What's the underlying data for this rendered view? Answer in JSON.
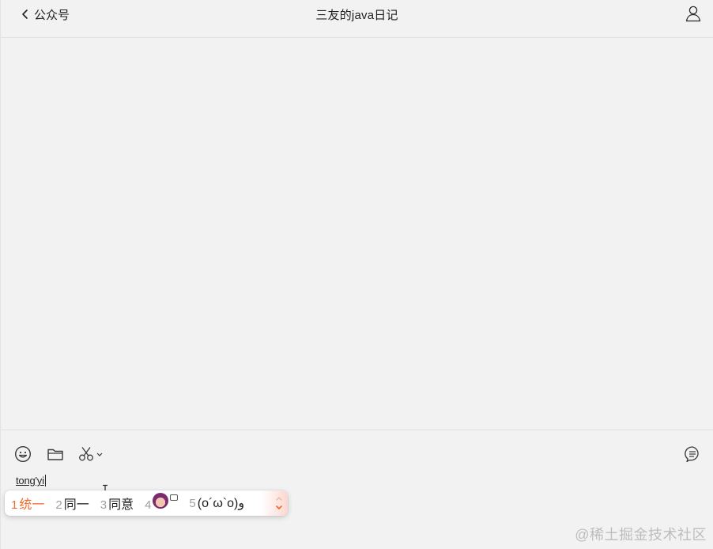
{
  "header": {
    "back_label": "公众号",
    "title": "三友的java日记"
  },
  "composer": {
    "typed_text": "tong'yi"
  },
  "ime": {
    "candidates": [
      {
        "num": "1",
        "text": "统一"
      },
      {
        "num": "2",
        "text": "同一"
      },
      {
        "num": "3",
        "text": "同意"
      },
      {
        "num": "4",
        "text": ""
      },
      {
        "num": "5",
        "text": "(o´ω`o)ﻭ"
      }
    ],
    "selected_index": 0
  },
  "watermark": "@稀土掘金技术社区",
  "colors": {
    "background": "#f2f2f2",
    "accent_selected": "#ee6b2c",
    "border": "#e1e1e1"
  },
  "icons": {
    "back": "chevron-left-icon",
    "profile": "person-icon",
    "emoji": "smiley-icon",
    "folder": "folder-icon",
    "screenshot": "scissors-icon",
    "chat_history": "chat-bubble-icon"
  }
}
